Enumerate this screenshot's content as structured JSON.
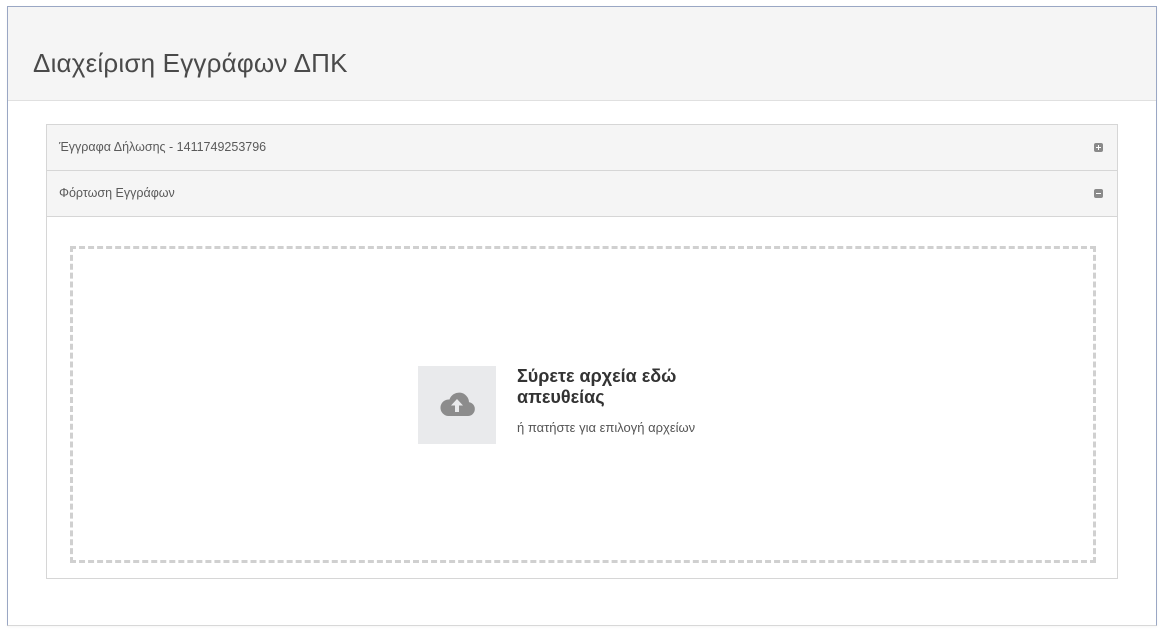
{
  "page": {
    "title": "Διαχείριση Εγγράφων ΔΠΚ"
  },
  "panels": [
    {
      "label": "Έγγραφα Δήλωσης - 1411749253796",
      "state": "collapsed",
      "toggle_icon": "plus-square-icon"
    },
    {
      "label": "Φόρτωση Εγγράφων",
      "state": "expanded",
      "toggle_icon": "minus-square-icon"
    }
  ],
  "dropzone": {
    "title": "Σύρετε αρχεία εδώ απευθείας",
    "subtitle": "ή πατήστε για επιλογή αρχείων",
    "icon": "cloud-upload-icon"
  },
  "colors": {
    "header_bg": "#f5f5f5",
    "border": "#d6d6d6",
    "dropzone_border": "#d0d0d0",
    "icon_box_bg": "#e9eaec",
    "icon_color": "#8c8c8c"
  }
}
